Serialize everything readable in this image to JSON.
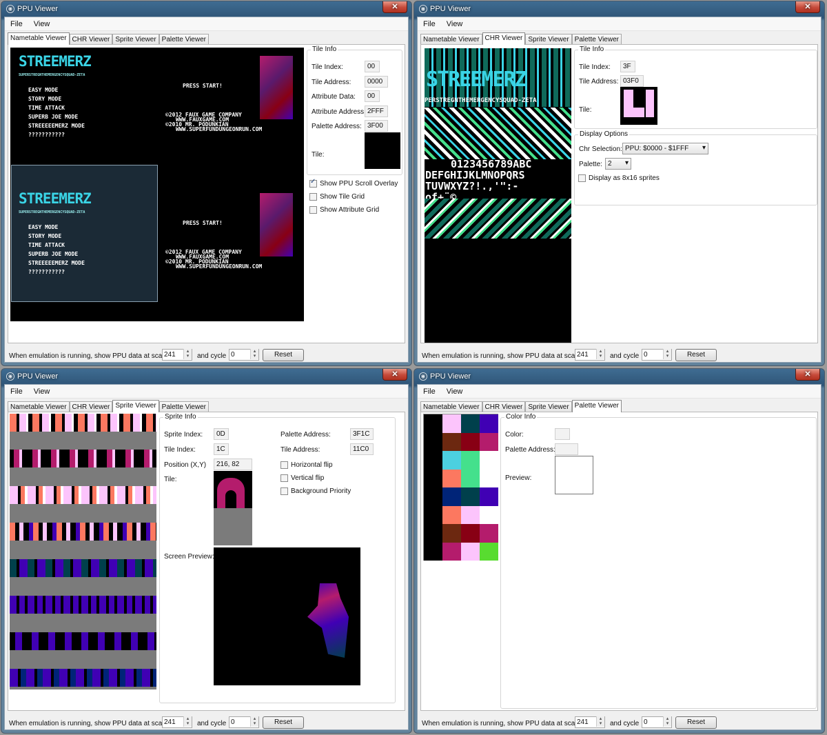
{
  "window_title": "PPU Viewer",
  "close_symbol": "✕",
  "menu": {
    "file": "File",
    "view": "View"
  },
  "tabs": {
    "nametable": "Nametable Viewer",
    "chr": "CHR Viewer",
    "sprite": "Sprite Viewer",
    "palette": "Palette Viewer"
  },
  "footer": {
    "prefix": "When emulation is running, show PPU data at scanline",
    "scanline": "241",
    "and_cycle": "and cycle",
    "cycle": "0",
    "reset": "Reset"
  },
  "nametable": {
    "group": "Tile Info",
    "tile_index_label": "Tile Index:",
    "tile_index": "00",
    "tile_address_label": "Tile Address:",
    "tile_address": "0000",
    "attribute_data_label": "Attribute Data:",
    "attribute_data": "00",
    "attribute_address_label": "Attribute Address:",
    "attribute_address": "2FFF",
    "palette_address_label": "Palette Address:",
    "palette_address": "3F00",
    "tile_label": "Tile:",
    "show_scroll": "Show PPU Scroll Overlay",
    "show_scroll_checked": true,
    "show_tile_grid": "Show Tile Grid",
    "show_attr_grid": "Show Attribute Grid",
    "screen": {
      "logo": "STREEMERZ",
      "subtitle": "SUPERSTREGNTHEMERGENCYSQUAD-ZETA",
      "press_start": "PRESS START!",
      "menu_items": [
        "EASY MODE",
        "STORY MODE",
        "TIME ATTACK",
        "SUPERB JOE MODE",
        "STREEEEEMERZ MODE",
        "???????????"
      ],
      "credits": [
        "©2012 FAUX GAME COMPANY",
        "WWW.FAUXGAME.COM",
        "©2010 MR. PODUNKIAN",
        "WWW.SUPERFUNDUNGEONRUN.COM"
      ]
    }
  },
  "chr": {
    "group": "Tile Info",
    "tile_index_label": "Tile Index:",
    "tile_index": "3F",
    "tile_address_label": "Tile Address:",
    "tile_address": "03F0",
    "tile_label": "Tile:",
    "options_group": "Display Options",
    "chr_selection_label": "Chr Selection:",
    "chr_selection": "PPU: $0000 - $1FFF",
    "palette_label": "Palette:",
    "palette": "2",
    "display_8x16": "Display as 8x16 sprites",
    "pattern_rows": [
      "0123456789ABC",
      "DEFGHIJKLMNOPQRS",
      "TUVWXYZ?!.,'\":-",
      "of+¨©"
    ],
    "logo_text": "STREEMERZ",
    "logo_sub": "PERSTREGNTHEMERGENCYSQUAD-ZETA"
  },
  "sprite": {
    "group": "Sprite Info",
    "sprite_index_label": "Sprite Index:",
    "sprite_index": "0D",
    "tile_index_label": "Tile Index:",
    "tile_index": "1C",
    "position_label": "Position (X,Y)",
    "position": "216, 82",
    "tile_label": "Tile:",
    "palette_address_label": "Palette Address:",
    "palette_address": "3F1C",
    "tile_address_label": "Tile Address:",
    "tile_address": "11C0",
    "hflip": "Horizontal flip",
    "vflip": "Vertical flip",
    "priority": "Background Priority",
    "screen_preview_label": "Screen Preview:"
  },
  "palette": {
    "group": "Color Info",
    "color_label": "Color:",
    "palette_address_label": "Palette Address:",
    "preview_label": "Preview:",
    "colors": [
      [
        "#000000",
        "#fcc4fc",
        "#00404c",
        "#4000b4"
      ],
      [
        "#000000",
        "#6c2810",
        "#880014",
        "#b41c6c"
      ],
      [
        "#000000",
        "#4cd0e0",
        "#44e08c",
        "#ffffff"
      ],
      [
        "#000000",
        "#fc7860",
        "#44e08c",
        "#ffffff"
      ],
      [
        "#000000",
        "#002478",
        "#00404c",
        "#4000b4"
      ],
      [
        "#000000",
        "#fc7860",
        "#fcc4fc",
        "#ffffff"
      ],
      [
        "#000000",
        "#6c2810",
        "#880014",
        "#b41c6c"
      ],
      [
        "#000000",
        "#b41c6c",
        "#fcc4fc",
        "#58dc30"
      ]
    ]
  }
}
